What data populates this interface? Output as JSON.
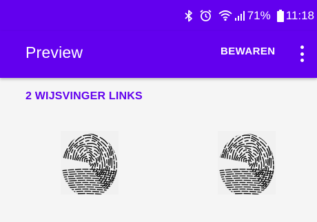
{
  "status_bar": {
    "battery_percent": "71%",
    "time": "11:18",
    "icons": [
      "bluetooth-icon",
      "alarm-icon",
      "wifi-icon",
      "signal-icon",
      "battery-icon"
    ]
  },
  "app_bar": {
    "title": "Preview",
    "save_label": "BEWAREN",
    "more_icon": "more-vert-icon"
  },
  "content": {
    "section_title": "2 WIJSVINGER LINKS",
    "images": [
      "fingerprint-image",
      "fingerprint-image"
    ]
  },
  "colors": {
    "primary": "#6200ee",
    "background": "#f5f5f5",
    "on_primary": "#ffffff"
  }
}
